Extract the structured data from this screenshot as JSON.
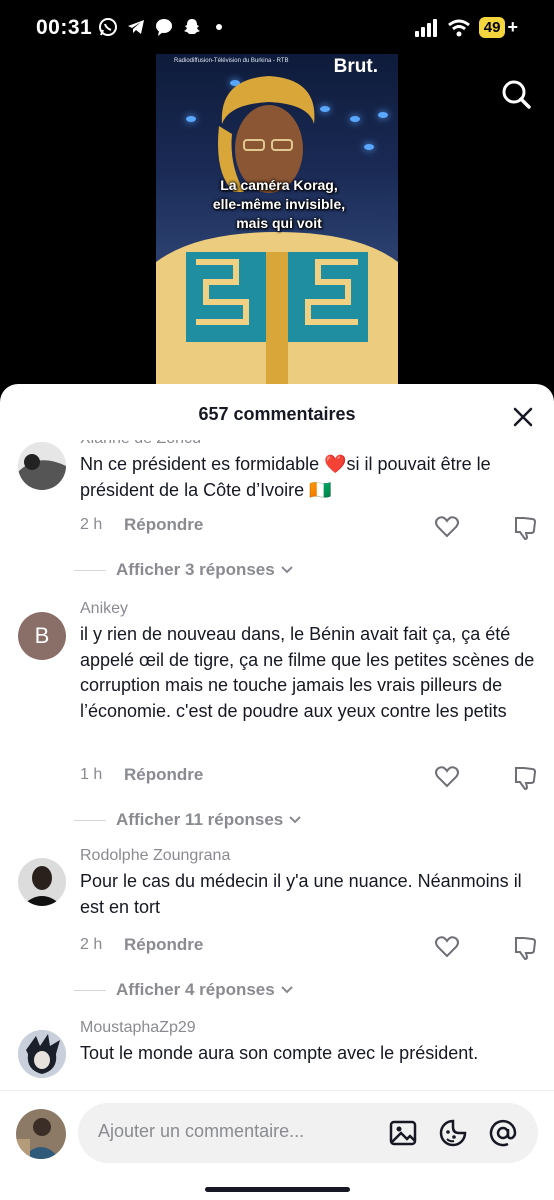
{
  "status_bar": {
    "time": "00:31",
    "battery": "49",
    "battery_plus": "+"
  },
  "video": {
    "source_label": "Radiodiffusion-Télévision du Burkina - RTB",
    "logo": "Brut.",
    "subtitle_lines": [
      "La caméra Korag,",
      "elle-même invisible,",
      "mais qui voit"
    ]
  },
  "comments_sheet": {
    "title": "657 commentaires",
    "comments": [
      {
        "username": "Xianne de Zoncu",
        "text": "Nn ce président es formidable ❤️si il pouvait être le président de la Côte d’Ivoire 🇨🇮",
        "time": "2 h",
        "reply_label": "Répondre",
        "view_replies": "Afficher 3 réponses"
      },
      {
        "username": "Anikey",
        "avatar_letter": "B",
        "text": "il y rien de nouveau dans, le Bénin avait fait ça, ça été appelé œil de tigre, ça ne filme que les petites scènes de corruption mais ne touche jamais les vrais pilleurs de l’économie. c'est de poudre aux yeux contre les petits",
        "time": "1 h",
        "reply_label": "Répondre",
        "view_replies": "Afficher 11 réponses"
      },
      {
        "username": "Rodolphe Zoungrana",
        "text": "Pour le cas du médecin il y'a une nuance. Néanmoins il est en tort",
        "time": "2 h",
        "reply_label": "Répondre",
        "view_replies": "Afficher 4 réponses"
      },
      {
        "username": "MoustaphaZp29",
        "text": "Tout le monde aura son compte avec le président.",
        "time": "",
        "reply_label": ""
      }
    ]
  },
  "input": {
    "placeholder": "Ajouter un commentaire..."
  },
  "icons": [
    "whatsapp-icon",
    "telegram-icon",
    "messenger-icon",
    "snapchat-icon",
    "signal-icon",
    "wifi-icon",
    "search-icon",
    "close-icon",
    "heart-icon",
    "dislike-icon",
    "chevron-down-icon",
    "image-icon",
    "emoji-icon",
    "mention-icon"
  ],
  "colors": {
    "accent_battery": "#f5d53d",
    "text_primary": "#161823",
    "text_secondary": "#8a8b91",
    "heart_red": "#e0323a"
  }
}
